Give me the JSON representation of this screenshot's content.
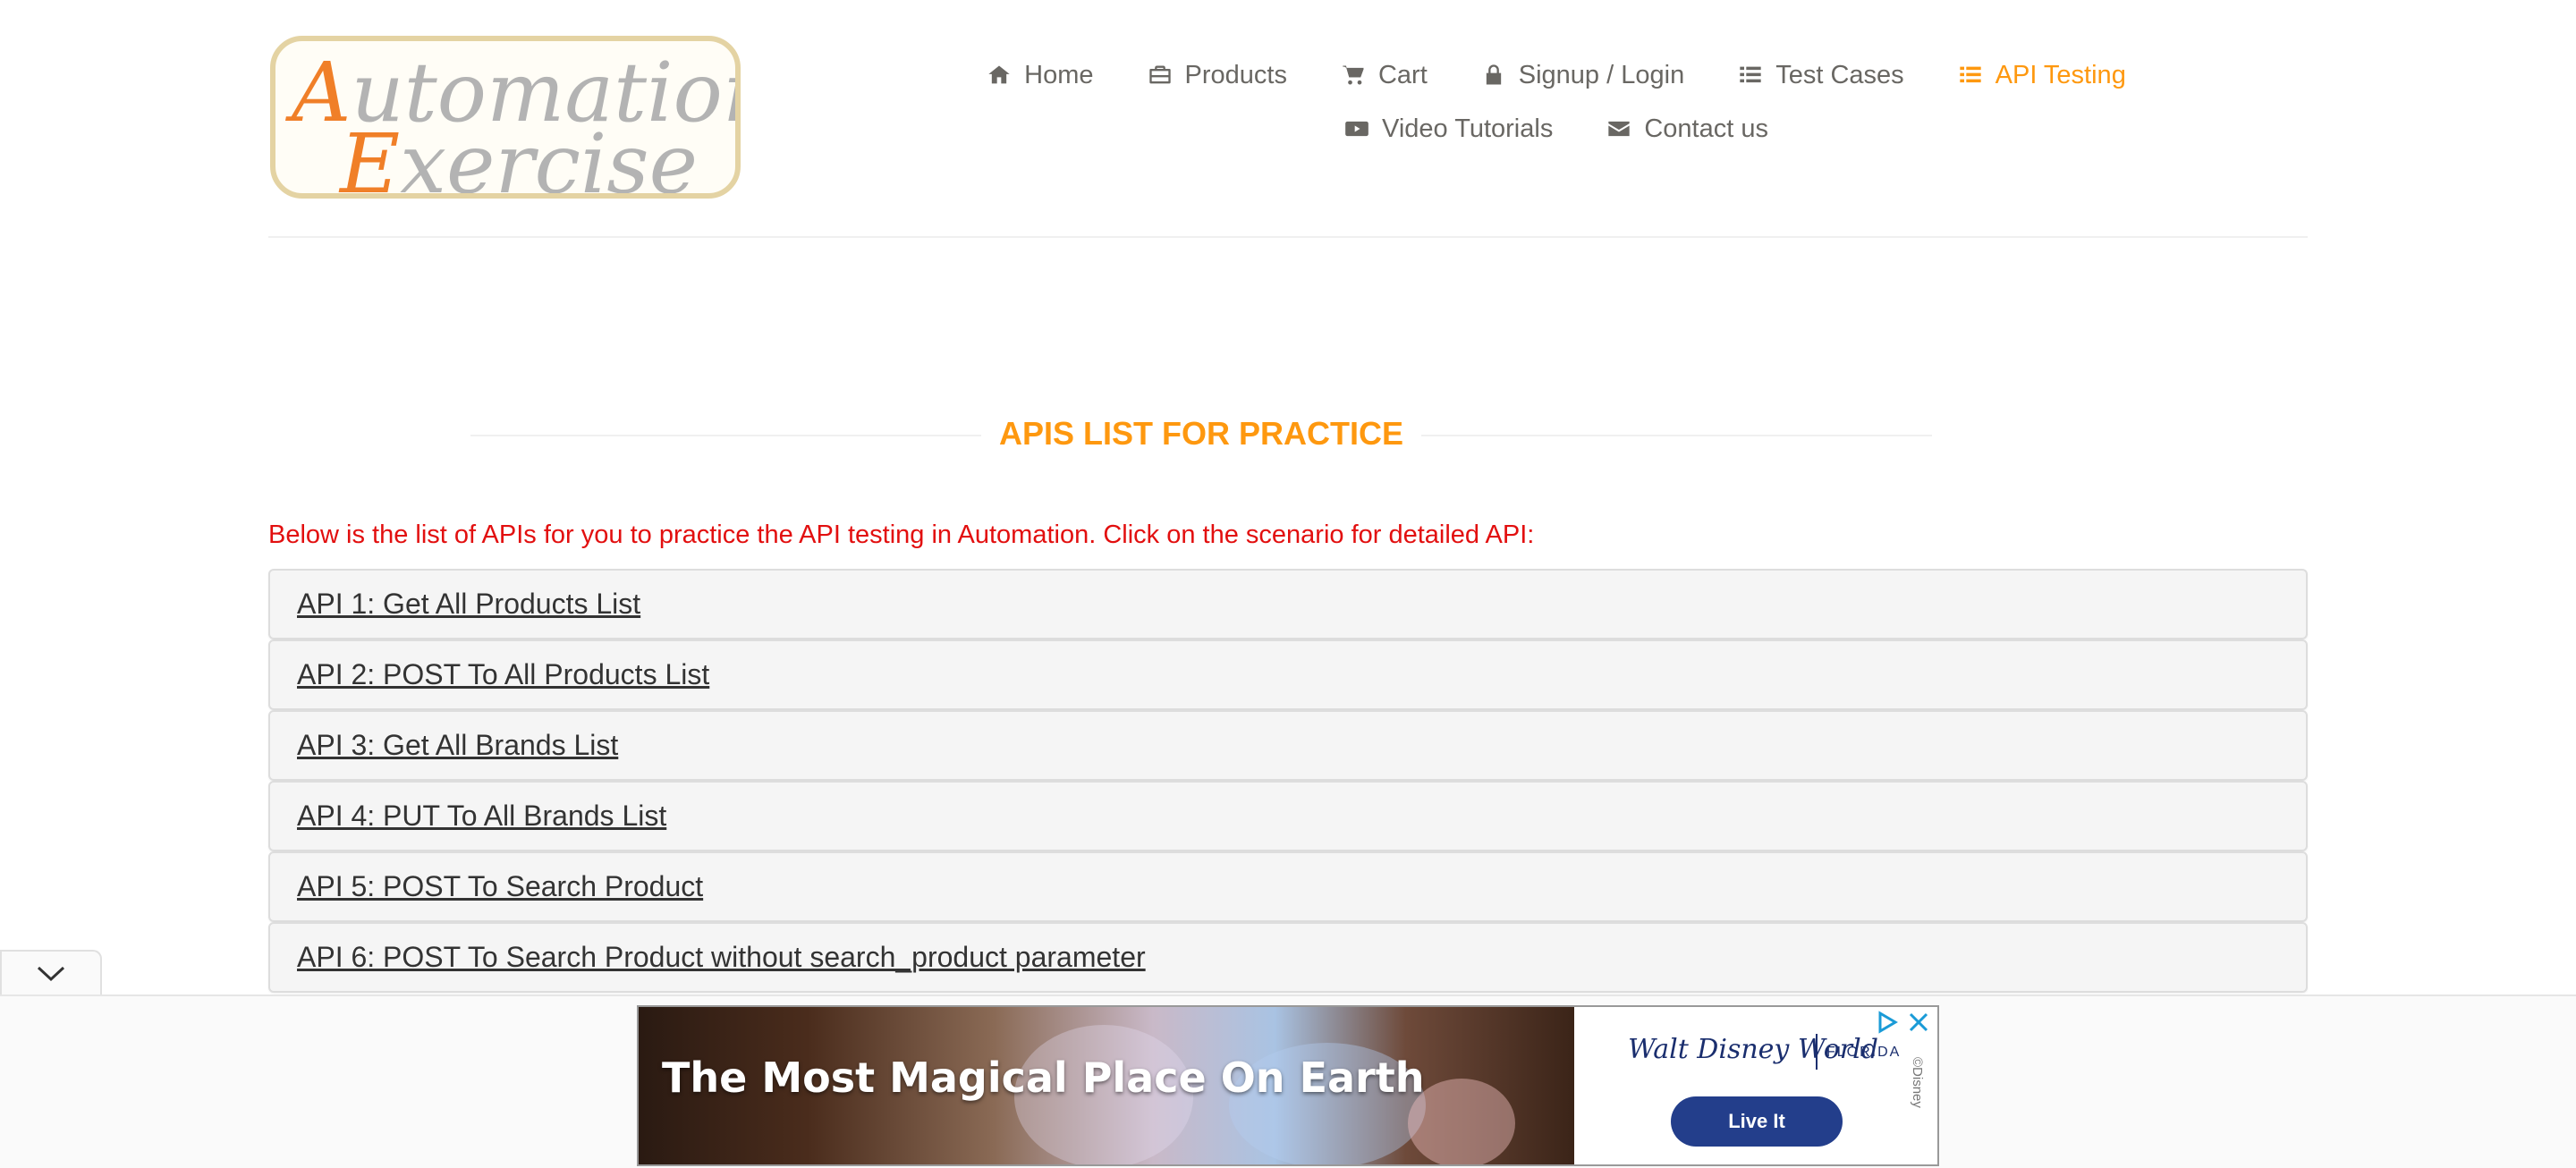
{
  "logo": {
    "line1_cap": "A",
    "line1_rest": "utomation",
    "line2_cap": "E",
    "line2_rest": "xercise"
  },
  "nav": {
    "row1": [
      {
        "label": "Home",
        "icon": "home-icon"
      },
      {
        "label": "Products",
        "icon": "briefcase-icon"
      },
      {
        "label": "Cart",
        "icon": "cart-icon"
      },
      {
        "label": "Signup / Login",
        "icon": "lock-icon"
      },
      {
        "label": "Test Cases",
        "icon": "list-icon"
      },
      {
        "label": "API Testing",
        "icon": "list-icon",
        "active": true
      }
    ],
    "row2": [
      {
        "label": "Video Tutorials",
        "icon": "youtube-icon"
      },
      {
        "label": "Contact us",
        "icon": "envelope-icon"
      }
    ]
  },
  "page": {
    "title": "APIS LIST FOR PRACTICE",
    "intro": "Below is the list of APIs for you to practice the API testing in Automation. Click on the scenario for detailed API:"
  },
  "apis": [
    "API 1: Get All Products List",
    "API 2: POST To All Products List",
    "API 3: Get All Brands List",
    "API 4: PUT To All Brands List",
    "API 5: POST To Search Product",
    "API 6: POST To Search Product without search_product parameter"
  ],
  "ad": {
    "headline": "The Most Magical Place On Earth",
    "brand": "Walt Disney World",
    "region": "FLORIDA",
    "cta": "Live It",
    "copyright": "©Disney"
  },
  "colors": {
    "accent": "#fe980f",
    "intro_text": "#e20f0f",
    "link": "#333333"
  }
}
